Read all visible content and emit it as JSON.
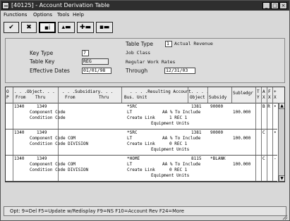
{
  "window": {
    "title": "[40125] - Account Derivation Table",
    "minimize_glyph": "_",
    "maximize_glyph": "□",
    "close_glyph": "×"
  },
  "menu": {
    "items": [
      "Functions",
      "Options",
      "Tools",
      "Help"
    ]
  },
  "toolbar": {
    "buttons": [
      {
        "name": "ok-button",
        "glyph": "✔",
        "icon": "checkmark-icon"
      },
      {
        "name": "cancel-button",
        "glyph": "✖",
        "icon": "x-icon"
      },
      {
        "name": "inquire-button",
        "glyph": "▪i",
        "icon": "info-icon"
      },
      {
        "name": "chart-button",
        "glyph": "▴▬",
        "icon": "chart-icon"
      },
      {
        "name": "tools-button",
        "glyph": "✚▬",
        "icon": "cross-icon"
      },
      {
        "name": "list-button",
        "glyph": "▪▬",
        "icon": "list-icon"
      }
    ]
  },
  "form": {
    "table_type_label": "Table Type",
    "table_type_value": "1",
    "table_type_desc": "Actual Revenue",
    "key_type_label": "Key Type",
    "key_type_value": "7",
    "key_type_desc": "Job Class",
    "table_key_label": "Table Key",
    "table_key_value": "REG",
    "table_key_desc": "Regular Work Rates",
    "effective_dates_label": "Effective Dates",
    "from_date": "01/01/98",
    "through_label": "Through",
    "through_date": "12/31/03"
  },
  "grid": {
    "headers": {
      "op_top": "O",
      "op_bottom": "P",
      "object_top": ". . .Object. . .",
      "object_from": "From",
      "object_thru": "Thru",
      "subsidiary_top": ". . .Subsidiary. . .",
      "subsidiary_from": "From",
      "subsidiary_thru": "Thru",
      "resulting_top": ". . . .Resulting Account. . . .",
      "resulting_bu": "Bus. Unit",
      "resulting_object": "Object",
      "resulting_subsidy": "Subsidy",
      "subledger": "Subledgr",
      "flag1": "T",
      "flag1b": "Y",
      "flag2": "A",
      "flag2b": "X",
      "flag3": "F",
      "flag3b": "X",
      "flag4": "+",
      "flag4b": "X"
    },
    "rows": [
      {
        "line1": {
          "from": "1340",
          "thru": "1349",
          "bu": "*SRC",
          "object": "1381",
          "subsidy": "90000",
          "flags": "B R",
          "mark": "•"
        },
        "line2": {
          "text": "Component Code",
          "bu": "LT",
          "mid": "AA % To Include",
          "amount": "100.000"
        },
        "line3": {
          "text": "Condition Code",
          "bu": "Create Link",
          "mid": "1 REC  1"
        },
        "line4": {
          "text": "Equipment   Units"
        }
      },
      {
        "line1": {
          "from": "1340",
          "thru": "1349",
          "bu": "*SRC",
          "object": "1381",
          "subsidy": "90000",
          "flags": "C",
          "mark": "•"
        },
        "line2": {
          "text": "Component Code COM",
          "bu": "LT",
          "mid": "AA % To Include",
          "amount": "100.000"
        },
        "line3": {
          "text": "Condition Code DIVISION",
          "bu": "Create Link",
          "mid": "0 REC  1"
        },
        "line4": {
          "text": "Equipment   Units"
        }
      },
      {
        "line1": {
          "from": "1340",
          "thru": "1349",
          "bu": "*HOME",
          "object": "8115",
          "subsidy": "*BLANK",
          "flags": "C",
          "mark": "-"
        },
        "line2": {
          "text": "Component Code COM",
          "bu": "LT",
          "mid": "AA % To Include",
          "amount": "100.000"
        },
        "line3": {
          "text": "Condition Code DIVISION",
          "bu": "Create Link",
          "mid": "0 REC  1"
        },
        "line4": {
          "text": "Equipment   Units"
        }
      }
    ],
    "scroll_up_glyph": "▲",
    "scroll_down_glyph": "▼"
  },
  "status": {
    "text": "Opt: 9=Del  F5=Update w/Redisplay  F9=NS  F10=Account Rev  F24=More"
  }
}
